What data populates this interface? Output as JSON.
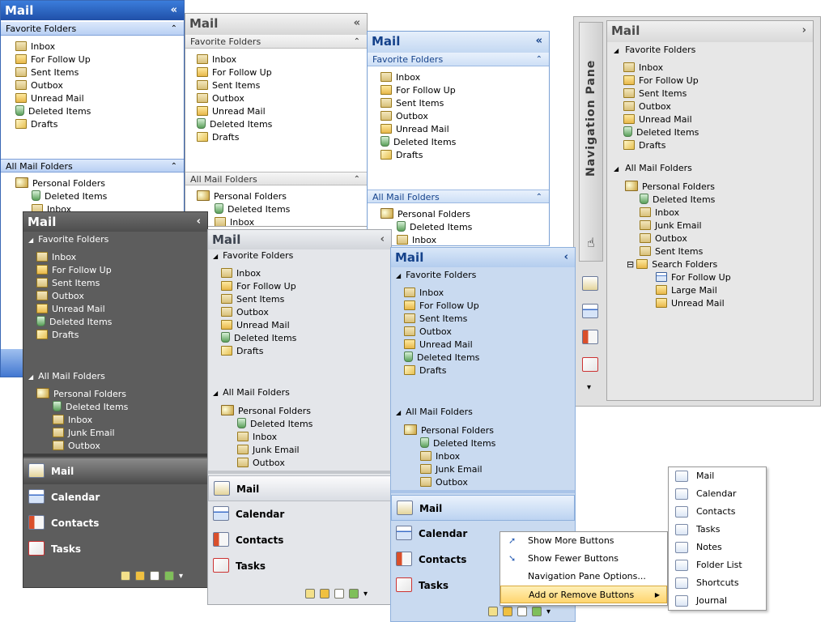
{
  "labels": {
    "mail": "Mail",
    "favorite_folders": "Favorite Folders",
    "all_mail_folders": "All Mail Folders",
    "personal_folders": "Personal Folders",
    "navigation_pane": "Navigation Pane",
    "collapse": "«",
    "collapse_single": "‹",
    "expand": "›",
    "section_collapse": "⌃",
    "tree_toggle": "◢",
    "tree_minus": "⊟",
    "chevron": "▾"
  },
  "favorites": [
    "Inbox",
    "For Follow Up",
    "Sent Items",
    "Outbox",
    "Unread Mail",
    "Deleted Items",
    "Drafts"
  ],
  "personal_tree": [
    "Deleted Items",
    "Inbox",
    "Junk Email",
    "Outbox",
    "Sent Items",
    "Search Folders",
    "For Follow Up",
    "Large Mail",
    "Unread Mail"
  ],
  "buttons": [
    "Mail",
    "Calendar",
    "Contacts",
    "Tasks"
  ],
  "context_menu": {
    "items": [
      "Show More Buttons",
      "Show Fewer Buttons",
      "Navigation Pane Options...",
      "Add or Remove Buttons"
    ],
    "submenu_arrow": "▶"
  },
  "submenu": [
    "Mail",
    "Calendar",
    "Contacts",
    "Tasks",
    "Notes",
    "Folder List",
    "Shortcuts",
    "Journal"
  ],
  "colors": {
    "blue_header": "#2a66c9",
    "blue_section": "#c7daf7",
    "silver": "#e3e3e3",
    "dark": "#4a4a4a",
    "light_blue": "#c5d9f1",
    "highlight": "#ffd56e"
  }
}
